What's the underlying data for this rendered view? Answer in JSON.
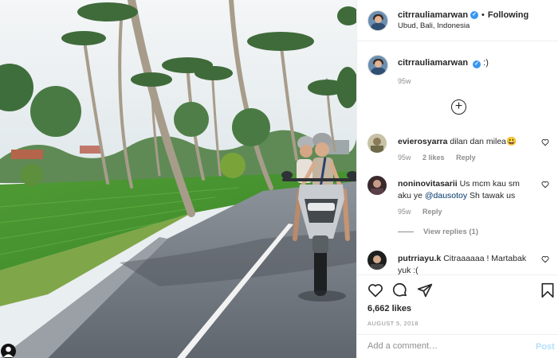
{
  "post": {
    "username": "citrrauliamarwan",
    "verified_badge": "✓",
    "follow_state": "Following",
    "location": "Ubud, Bali, Indonesia",
    "caption_text": ":)",
    "caption_time": "95w",
    "likes": "6,662 likes",
    "date": "AUGUST 5, 2018"
  },
  "load_more_icon": "+",
  "comments": [
    {
      "username": "evierosyarra",
      "text": "dilan dan milea😃",
      "time": "95w",
      "likes": "2 likes",
      "reply_label": "Reply"
    },
    {
      "username": "noninovitasarii",
      "text_before": "Us mcm kau sm aku ye ",
      "mention": "@dausotoy",
      "text_after": " Sh tawak us",
      "time": "95w",
      "reply_label": "Reply",
      "view_replies": "View replies (1)"
    },
    {
      "username": "putrriayu.k",
      "text": "Citraaaaaa ! Martabak yuk :("
    }
  ],
  "add_comment": {
    "placeholder": "Add a comment…",
    "post_label": "Post"
  },
  "icons": {
    "like": "heart-icon",
    "comment": "comment-bubble-icon",
    "share": "paper-plane-icon",
    "save": "bookmark-icon",
    "tag": "user-tag-icon"
  },
  "colors": {
    "verified": "#3897f0",
    "post_button_disabled": "#b2dffc",
    "secondary_text": "#8e8e8e",
    "mention": "#003569"
  }
}
